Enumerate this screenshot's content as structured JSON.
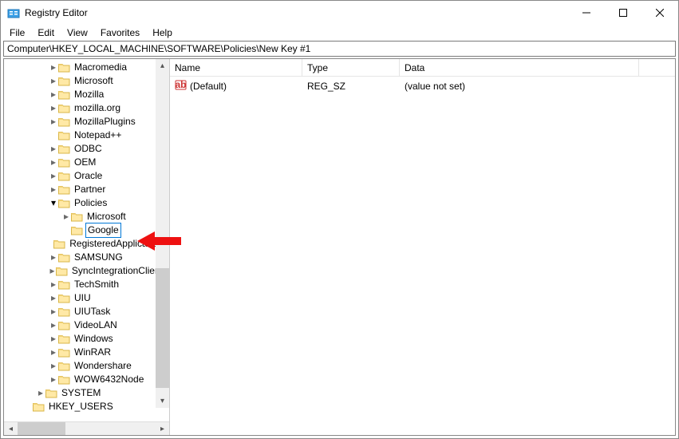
{
  "window": {
    "title": "Registry Editor"
  },
  "menu": {
    "file": "File",
    "edit": "Edit",
    "view": "View",
    "favorites": "Favorites",
    "help": "Help"
  },
  "address": "Computer\\HKEY_LOCAL_MACHINE\\SOFTWARE\\Policies\\New Key #1",
  "tree": {
    "items": [
      {
        "indent": 3,
        "exp": ">",
        "label": "Macromedia"
      },
      {
        "indent": 3,
        "exp": ">",
        "label": "Microsoft"
      },
      {
        "indent": 3,
        "exp": ">",
        "label": "Mozilla"
      },
      {
        "indent": 3,
        "exp": ">",
        "label": "mozilla.org"
      },
      {
        "indent": 3,
        "exp": ">",
        "label": "MozillaPlugins"
      },
      {
        "indent": 3,
        "exp": "",
        "label": "Notepad++"
      },
      {
        "indent": 3,
        "exp": ">",
        "label": "ODBC"
      },
      {
        "indent": 3,
        "exp": ">",
        "label": "OEM"
      },
      {
        "indent": 3,
        "exp": ">",
        "label": "Oracle"
      },
      {
        "indent": 3,
        "exp": ">",
        "label": "Partner"
      },
      {
        "indent": 3,
        "exp": "v",
        "label": "Policies"
      },
      {
        "indent": 4,
        "exp": ">",
        "label": "Microsoft"
      },
      {
        "indent": 4,
        "exp": "",
        "label": "Google",
        "editing": true
      },
      {
        "indent": 3,
        "exp": "",
        "label": "RegisteredApplications"
      },
      {
        "indent": 3,
        "exp": ">",
        "label": "SAMSUNG"
      },
      {
        "indent": 3,
        "exp": ">",
        "label": "SyncIntegrationClients"
      },
      {
        "indent": 3,
        "exp": ">",
        "label": "TechSmith"
      },
      {
        "indent": 3,
        "exp": ">",
        "label": "UIU"
      },
      {
        "indent": 3,
        "exp": ">",
        "label": "UIUTask"
      },
      {
        "indent": 3,
        "exp": ">",
        "label": "VideoLAN"
      },
      {
        "indent": 3,
        "exp": ">",
        "label": "Windows"
      },
      {
        "indent": 3,
        "exp": ">",
        "label": "WinRAR"
      },
      {
        "indent": 3,
        "exp": ">",
        "label": "Wondershare"
      },
      {
        "indent": 3,
        "exp": ">",
        "label": "WOW6432Node"
      },
      {
        "indent": 2,
        "exp": ">",
        "label": "SYSTEM"
      },
      {
        "indent": 1,
        "exp": "",
        "label": "HKEY_USERS"
      }
    ]
  },
  "columns": {
    "name": "Name",
    "type": "Type",
    "data": "Data"
  },
  "columnWidths": {
    "name": 166,
    "type": 122,
    "data": 300
  },
  "values": {
    "rows": [
      {
        "icon": "ab",
        "name": "(Default)",
        "type": "REG_SZ",
        "data": "(value not set)"
      }
    ]
  }
}
